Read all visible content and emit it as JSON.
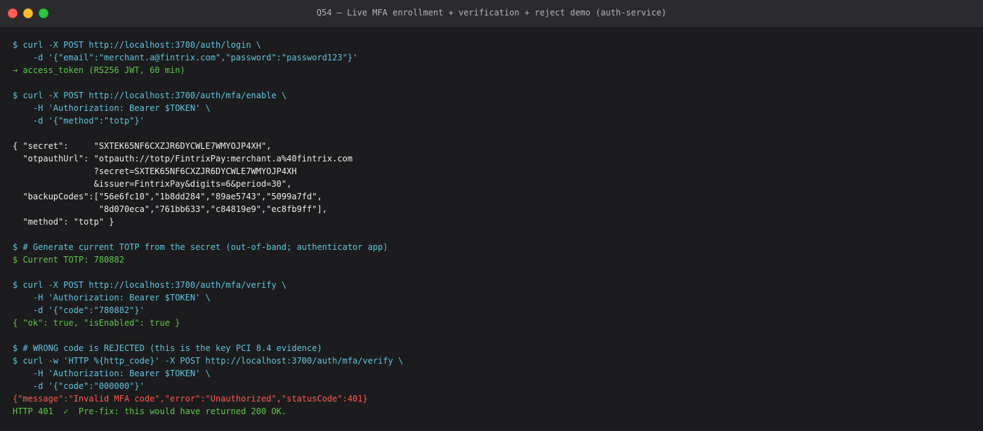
{
  "window": {
    "title": "Q54 — Live MFA enrollment + verification + reject demo (auth-service)",
    "buttons": {
      "close": "close-button",
      "minimize": "minimize-button",
      "maximize": "maximize-button"
    }
  },
  "terminal": {
    "lines": [
      "$ curl -X POST http://localhost:3700/auth/login \\",
      "    -d '{\"email\":\"merchant.a@fintrix.com\",\"password\":\"password123\"}'",
      "→ access_token (RS256 JWT, 60 min)",
      "",
      "$ curl -X POST http://localhost:3700/auth/mfa/enable \\",
      "    -H 'Authorization: Bearer $TOKEN' \\",
      "    -d '{\"method\":\"totp\"}'",
      "",
      "{ \"secret\":     \"SXTEK65NF6CXZJR6DYCWLE7WMYOJP4XH\",",
      "  \"otpauthUrl\": \"otpauth://totp/FintrixPay:merchant.a%40fintrix.com",
      "                ?secret=SXTEK65NF6CXZJR6DYCWLE7WMYOJP4XH",
      "                &issuer=FintrixPay&digits=6&period=30\",",
      "  \"backupCodes\":[\"56e6fc10\",\"1b8dd284\",\"89ae5743\",\"5099a7fd\",",
      "                 \"8d070eca\",\"761bb633\",\"c84819e9\",\"ec8fb9ff\"],",
      "  \"method\": \"totp\" }",
      "",
      "$ # Generate current TOTP from the secret (out-of-band; authenticator app)",
      "$ Current TOTP: 780882",
      "",
      "$ curl -X POST http://localhost:3700/auth/mfa/verify \\",
      "    -H 'Authorization: Bearer $TOKEN' \\",
      "    -d '{\"code\":\"780882\"}'",
      "{ \"ok\": true, \"isEnabled\": true }",
      "",
      "$ # WRONG code is REJECTED (this is the key PCI 8.4 evidence)",
      "$ curl -w 'HTTP %{http_code}' -X POST http://localhost:3700/auth/mfa/verify \\",
      "    -H 'Authorization: Bearer $TOKEN' \\",
      "    -d '{\"code\":\"000000\"}'",
      "{\"message\":\"Invalid MFA code\",\"error\":\"Unauthorized\",\"statusCode\":401}",
      "HTTP 401  ✓  Pre-fix: this would have returned 200 OK."
    ],
    "line_colors": [
      "cyan",
      "cyan",
      "green",
      "",
      "cyan",
      "cyan",
      "cyan",
      "",
      "white",
      "white",
      "white",
      "white",
      "white",
      "white",
      "white",
      "",
      "cyan",
      "green",
      "",
      "cyan",
      "cyan",
      "cyan",
      "green",
      "",
      "cyan",
      "cyan",
      "cyan",
      "cyan",
      "red",
      "green"
    ]
  },
  "colors": {
    "background": "#1c1c1e",
    "titlebar": "#2b2b2e",
    "command": "#5fc3dd",
    "success": "#5ec54a",
    "output": "#ececec",
    "error": "#ff5a4e"
  }
}
